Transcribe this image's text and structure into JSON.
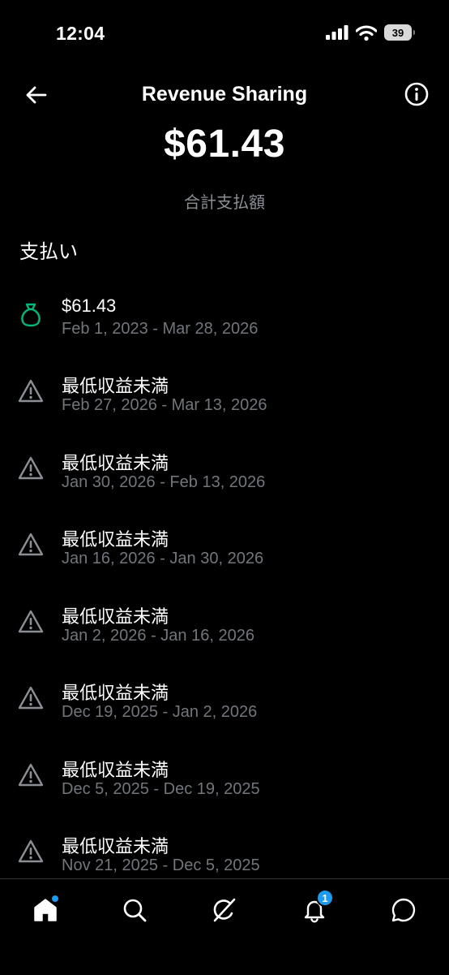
{
  "status_bar": {
    "time": "12:04",
    "battery_level": "39",
    "icons": [
      "signal-icon",
      "wifi-icon",
      "battery-icon"
    ]
  },
  "header": {
    "title": "Revenue Sharing",
    "back_icon": "arrow-left-icon",
    "info_icon": "info-icon"
  },
  "summary": {
    "total_amount": "$61.43",
    "total_label": "合計支払額"
  },
  "section_title": "支払い",
  "payments": [
    {
      "icon": "money-bag-icon",
      "title": "$61.43",
      "period": "Feb 1, 2023 - Mar 28, 2026"
    },
    {
      "icon": "warning-icon",
      "title": "最低収益未満",
      "period": "Feb 27, 2026 - Mar 13, 2026"
    },
    {
      "icon": "warning-icon",
      "title": "最低収益未満",
      "period": "Jan 30, 2026 - Feb 13, 2026"
    },
    {
      "icon": "warning-icon",
      "title": "最低収益未満",
      "period": "Jan 16, 2026 - Jan 30, 2026"
    },
    {
      "icon": "warning-icon",
      "title": "最低収益未満",
      "period": "Jan 2, 2026 - Jan 16, 2026"
    },
    {
      "icon": "warning-icon",
      "title": "最低収益未満",
      "period": "Dec 19, 2025 - Jan 2, 2026"
    },
    {
      "icon": "warning-icon",
      "title": "最低収益未満",
      "period": "Dec 5, 2025 - Dec 19, 2025"
    },
    {
      "icon": "warning-icon",
      "title": "最低収益未満",
      "period": "Nov 21, 2025 - Dec 5, 2025"
    }
  ],
  "bottom_nav": {
    "items": [
      "home-icon",
      "search-icon",
      "grok-icon",
      "notifications-icon",
      "messages-icon"
    ],
    "notification_count": "1"
  },
  "colors": {
    "background": "#000000",
    "accent": "#1d9bf0",
    "secondary_text": "#71767b",
    "money_green": "#00ba7c"
  }
}
